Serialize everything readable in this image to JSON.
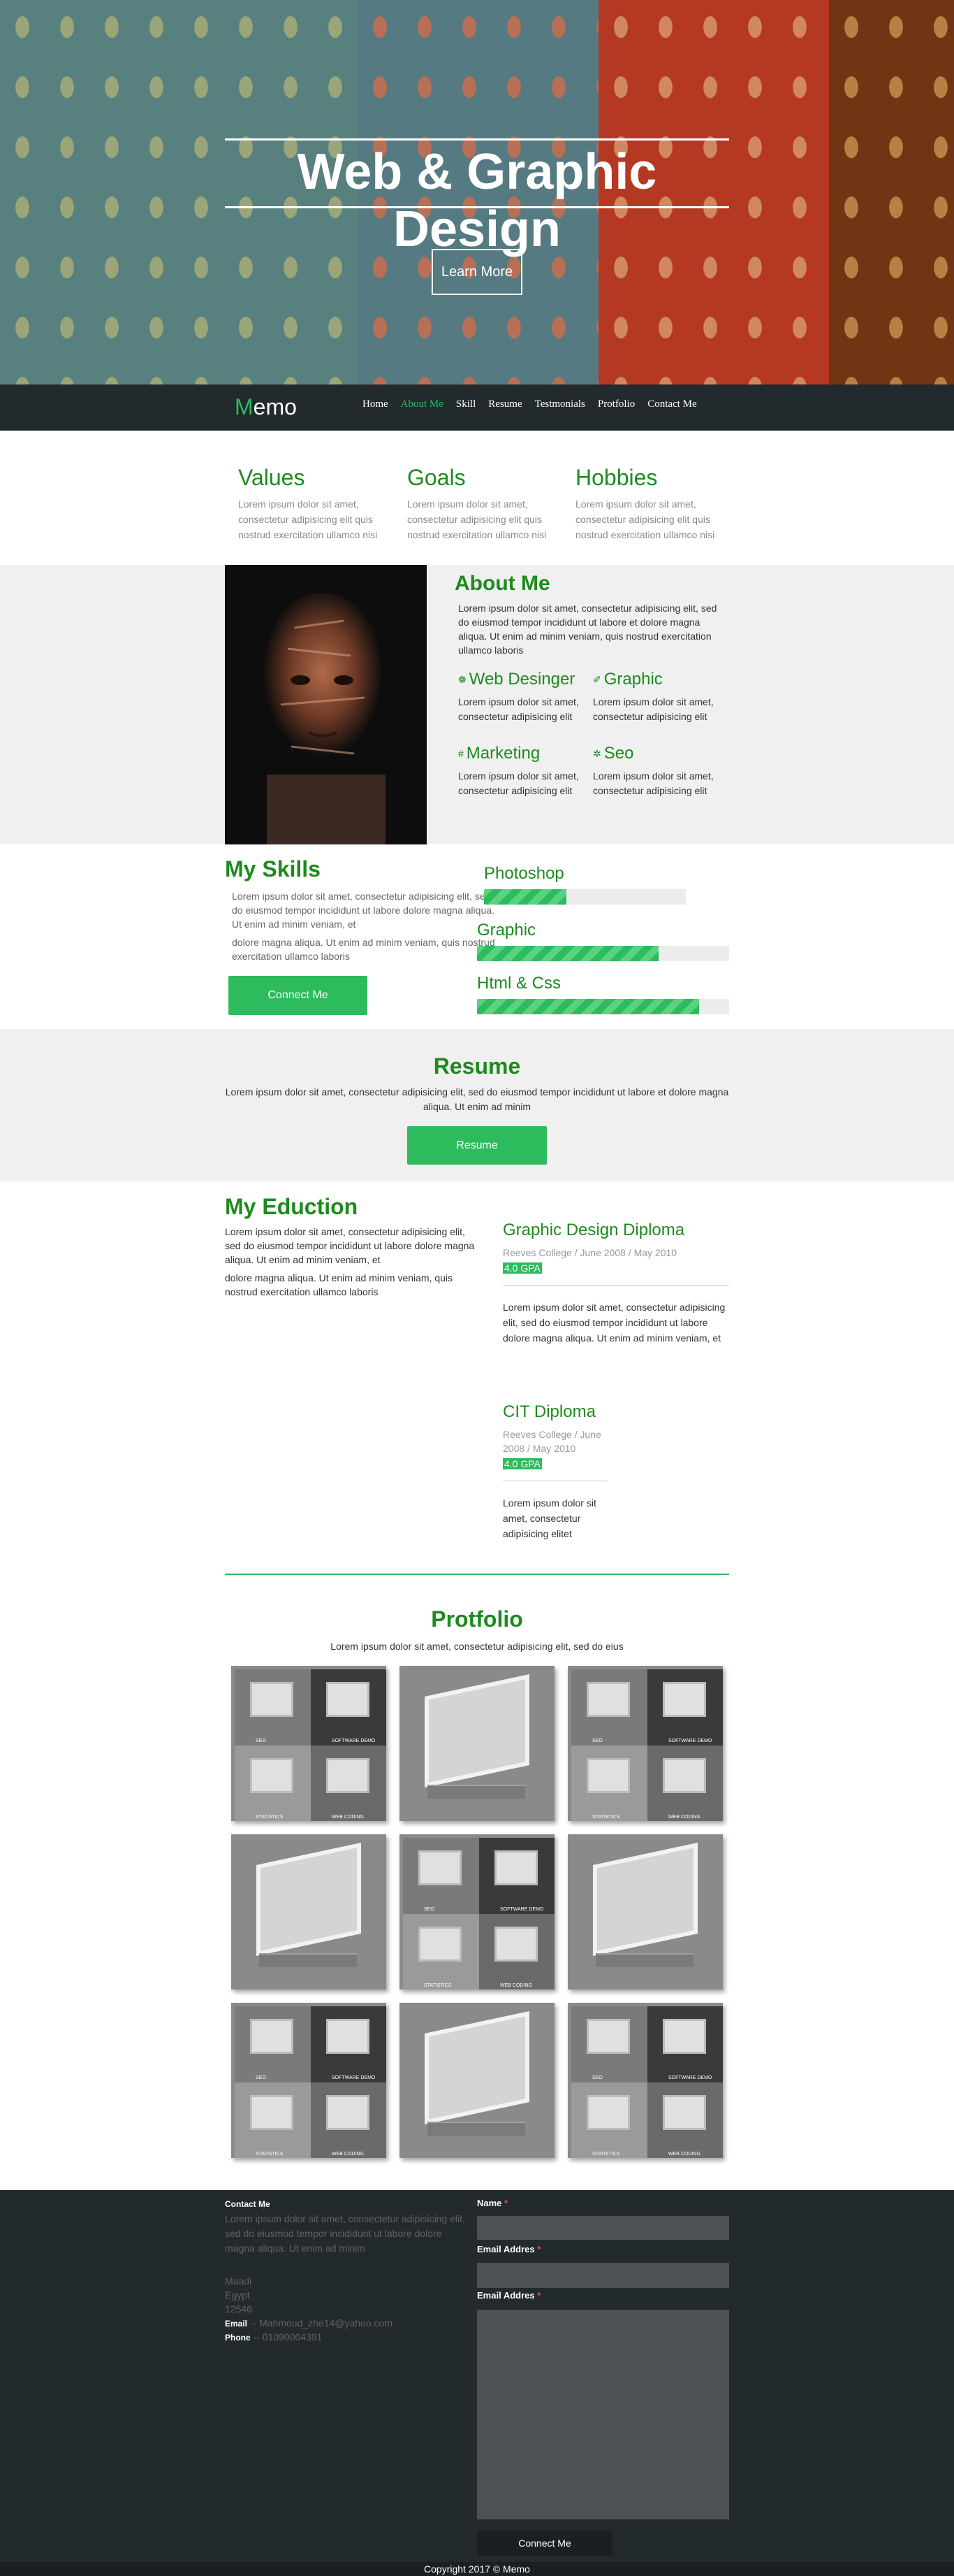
{
  "hero": {
    "title": "Web & Graphic Design",
    "button": "Learn More"
  },
  "nav": {
    "logo_first": "M",
    "logo_rest": "emo",
    "items": [
      "Home",
      "About Me",
      "Skill",
      "Resume",
      "Testmonials",
      "Protfolio",
      "Contact Me"
    ],
    "active": "About Me"
  },
  "values": [
    {
      "title": "Values",
      "text": "Lorem ipsum dolor sit amet, consectetur adipisicing elit quis nostrud exercitation ullamco nisi"
    },
    {
      "title": "Goals",
      "text": "Lorem ipsum dolor sit amet, consectetur adipisicing elit quis nostrud exercitation ullamco nisi"
    },
    {
      "title": "Hobbies",
      "text": "Lorem ipsum dolor sit amet, consectetur adipisicing elit quis nostrud exercitation ullamco nisi"
    }
  ],
  "about": {
    "title": "About Me",
    "text": "Lorem ipsum dolor sit amet, consectetur adipisicing elit, sed do eiusmod tempor incididunt ut labore et dolore magna aliqua. Ut enim ad minim veniam, quis nostrud exercitation ullamco laboris",
    "services": [
      {
        "title": "Web Desinger",
        "icon": "globe-icon",
        "glyph": "❁",
        "text": "Lorem ipsum dolor sit amet, consectetur adipisicing elit"
      },
      {
        "title": "Graphic",
        "icon": "brush-icon",
        "glyph": "✐",
        "text": "Lorem ipsum dolor sit amet, consectetur adipisicing elit"
      },
      {
        "title": "Marketing",
        "icon": "tag-icon",
        "glyph": "#",
        "text": "Lorem ipsum dolor sit amet, consectetur adipisicing elit"
      },
      {
        "title": "Seo",
        "icon": "gear-icon",
        "glyph": "✲",
        "text": "Lorem ipsum dolor sit amet, consectetur adipisicing elit"
      }
    ]
  },
  "skills": {
    "title": "My Skills",
    "text1": "Lorem ipsum dolor sit amet, consectetur adipisicing elit, sed do eiusmod tempor incididunt ut labore dolore magna aliqua. Ut enim ad minim veniam, et",
    "text2": "dolore magna aliqua. Ut enim ad minim veniam, quis nostrud exercitation ullamco laboris",
    "button": "Connect Me",
    "bars": [
      {
        "label": "Photoshop",
        "level": 0.41
      },
      {
        "label": "Graphic",
        "level": 0.72
      },
      {
        "label": "Html & Css",
        "level": 0.88
      }
    ]
  },
  "resume": {
    "title": "Resume",
    "text": "Lorem ipsum dolor sit amet, consectetur adipisicing elit, sed do eiusmod tempor incididunt ut labore et dolore magna aliqua. Ut enim ad minim",
    "button": "Resume"
  },
  "education": {
    "title": "My Eduction",
    "text1": "Lorem ipsum dolor sit amet, consectetur adipisicing elit, sed do eiusmod tempor incididunt ut labore dolore magna aliqua. Ut enim ad minim veniam, et",
    "text2": "dolore magna aliqua. Ut enim ad minim veniam, quis nostrud exercitation ullamco laboris",
    "diplomas": [
      {
        "title": "Graphic Design Diploma",
        "meta": "Reeves College / June 2008 / May 2010",
        "gpa": "4.0 GPA",
        "text": "Lorem ipsum dolor sit amet, consectetur adipisicing elit, sed do eiusmod tempor incididunt ut labore dolore magna aliqua. Ut enim ad minim veniam, et"
      },
      {
        "title": "CIT Diploma",
        "meta": "Reeves College / June 2008 / May 2010",
        "gpa": "4.0 GPA",
        "text": "Lorem ipsum dolor sit amet, consectetur adipisicing elitet"
      }
    ]
  },
  "portfolio": {
    "title": "Protfolio",
    "text": "Lorem ipsum dolor sit amet, consectetur adipisicing elit, sed do eius",
    "captions": [
      "SEO",
      "SOFTWARE DEMO",
      "STATISTICS",
      "WEB CODING"
    ],
    "items": [
      "grid",
      "monitor",
      "grid",
      "monitor",
      "grid",
      "monitor",
      "grid",
      "monitor",
      "grid"
    ]
  },
  "footer": {
    "heading": "Contact Me",
    "text": "Lorem ipsum dolor sit amet, consectetur adipisicing elit, sed do eiusmod tempor incididunt ut labore dolore magna aliqua. Ut enim ad minim",
    "city": "Maadi",
    "country": "Egypt",
    "zip": "12546",
    "email_label": "Email",
    "email": "-- Mahmoud_zhe14@yahoo.com",
    "phone_label": "Phone",
    "phone": "-- 01090004391",
    "name_label": "Name",
    "email_field_label": "Email Addres",
    "message_label": "Email Addres",
    "required": "*",
    "button": "Connect Me",
    "copyright": "Copyright 2017 © Memo"
  }
}
